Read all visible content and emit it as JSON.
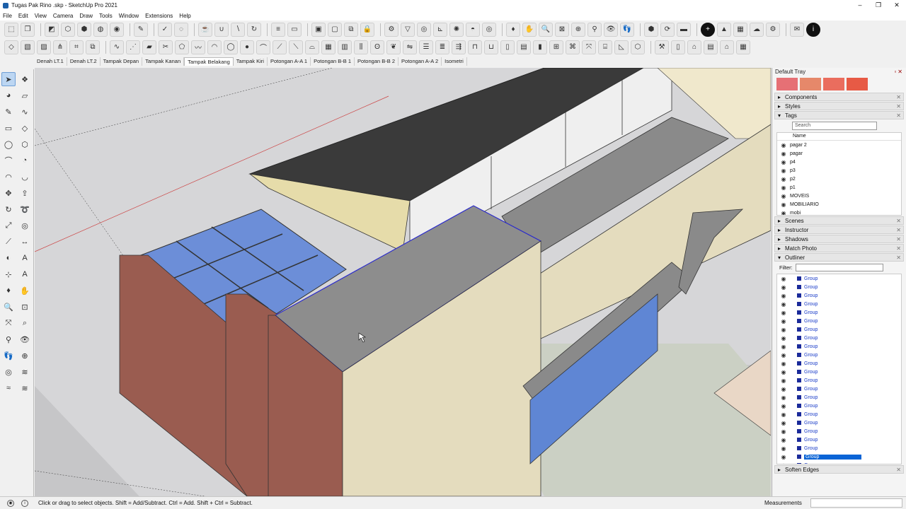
{
  "window": {
    "title": "Tugas Pak Rino .skp - SketchUp Pro 2021",
    "controls": [
      "–",
      "❐",
      "✕"
    ]
  },
  "menu": [
    "File",
    "Edit",
    "View",
    "Camera",
    "Draw",
    "Tools",
    "Window",
    "Extensions",
    "Help"
  ],
  "scene_tabs": [
    "Denah LT.1",
    "Denah LT.2",
    "Tampak Depan",
    "Tampak Kanan",
    "Tampak Belakang",
    "Tampak Kiri",
    "Potongan A-A 1",
    "Potongan B-B 1",
    "Potongan B-B 2",
    "Potongan A-A 2",
    "Isometri"
  ],
  "active_scene": "Tampak Belakang",
  "tray": {
    "title": "Default Tray",
    "swatch_colors": [
      "#e67075",
      "#e6886a",
      "#ea6d5e",
      "#e75a45"
    ],
    "panels_top": [
      "Components",
      "Styles"
    ],
    "tags": {
      "header": "Tags",
      "search_placeholder": "Search",
      "column_name": "Name",
      "items": [
        "pagar 2",
        "pagar",
        "p4",
        "p3",
        "p2",
        "p1",
        "MOVEIS",
        "MOBILIARIO",
        "mobi"
      ]
    },
    "panels_mid": [
      "Scenes",
      "Instructor",
      "Shadows",
      "Match Photo"
    ],
    "outliner": {
      "header": "Outliner",
      "filter_label": "Filter:",
      "item_label": "Group",
      "row_count": 23,
      "selected_index": 21
    },
    "panel_bottom": "Soften Edges"
  },
  "status": {
    "message": "Click or drag to select objects. Shift = Add/Subtract. Ctrl = Add. Shift + Ctrl = Subtract.",
    "measurements_label": "Measurements"
  }
}
